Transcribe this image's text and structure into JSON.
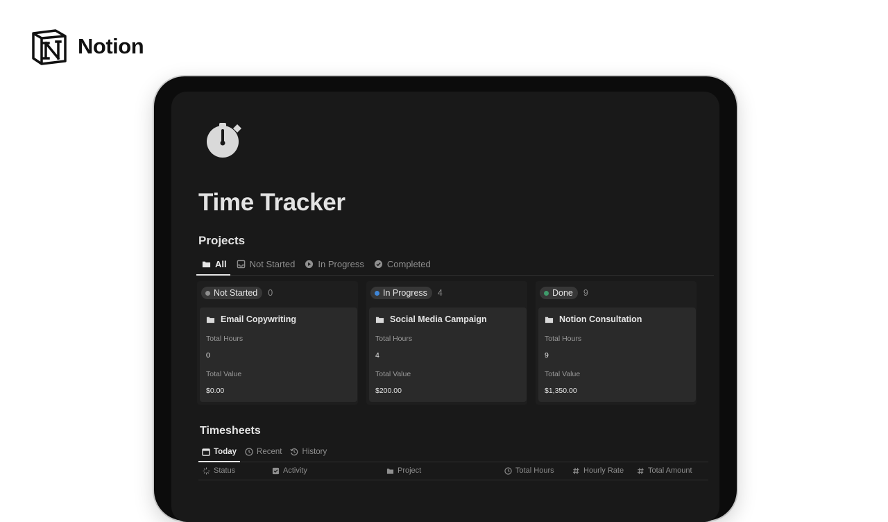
{
  "brand": {
    "name": "Notion",
    "logo_icon": "notion-logo-icon"
  },
  "page": {
    "icon": "stopwatch-icon",
    "title": "Time Tracker"
  },
  "projects": {
    "title": "Projects",
    "tabs": [
      {
        "label": "All",
        "icon": "folder-icon",
        "active": true
      },
      {
        "label": "Not Started",
        "icon": "inbox-icon",
        "active": false
      },
      {
        "label": "In Progress",
        "icon": "play-circle-icon",
        "active": false
      },
      {
        "label": "Completed",
        "icon": "check-circle-icon",
        "active": false
      }
    ],
    "columns": [
      {
        "status": "Not Started",
        "count": "0",
        "dot_color": "#8f8f8f",
        "cards": [
          {
            "title": "Email Copywriting",
            "total_hours_label": "Total Hours",
            "total_hours": "0",
            "total_value_label": "Total Value",
            "total_value": "$0.00"
          }
        ]
      },
      {
        "status": "In Progress",
        "count": "4",
        "dot_color": "#3f86d8",
        "cards": [
          {
            "title": "Social Media Campaign",
            "total_hours_label": "Total Hours",
            "total_hours": "4",
            "total_value_label": "Total Value",
            "total_value": "$200.00"
          }
        ]
      },
      {
        "status": "Done",
        "count": "9",
        "dot_color": "#3f9b6b",
        "cards": [
          {
            "title": "Notion Consultation",
            "total_hours_label": "Total Hours",
            "total_hours": "9",
            "total_value_label": "Total Value",
            "total_value": "$1,350.00"
          }
        ]
      }
    ]
  },
  "timesheets": {
    "title": "Timesheets",
    "tabs": [
      {
        "label": "Today",
        "icon": "calendar-icon",
        "active": true
      },
      {
        "label": "Recent",
        "icon": "clock-icon",
        "active": false
      },
      {
        "label": "History",
        "icon": "history-icon",
        "active": false
      }
    ],
    "columns": [
      {
        "label": "Status",
        "icon": "loading-icon"
      },
      {
        "label": "Activity",
        "icon": "checkbox-icon"
      },
      {
        "label": "Project",
        "icon": "folder-icon"
      },
      {
        "label": "Total Hours",
        "icon": "clock-icon"
      },
      {
        "label": "Hourly Rate",
        "icon": "hash-icon"
      },
      {
        "label": "Total Amount",
        "icon": "hash-icon"
      }
    ]
  }
}
